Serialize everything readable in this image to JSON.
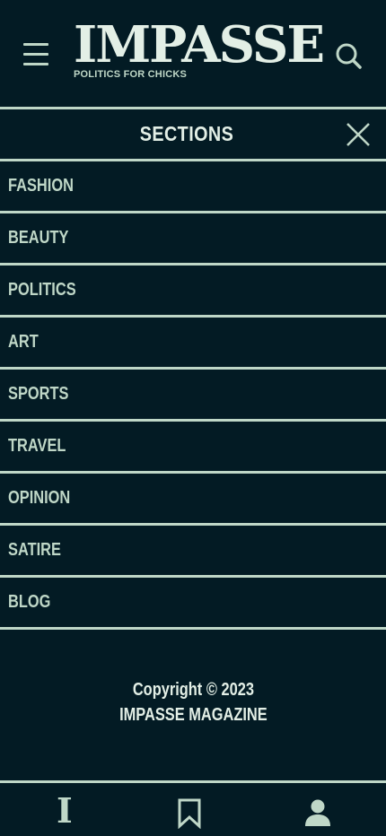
{
  "header": {
    "logo": "IMPASSE",
    "tagline": "POLITICS FOR CHICKS",
    "menu_icon": "hamburger-menu-icon",
    "search_icon": "search-icon"
  },
  "sections": {
    "title": "SECTIONS",
    "close_icon": "close-icon",
    "items": [
      {
        "label": "FASHION"
      },
      {
        "label": "BEAUTY"
      },
      {
        "label": "POLITICS"
      },
      {
        "label": "ART"
      },
      {
        "label": "SPORTS"
      },
      {
        "label": "TRAVEL"
      },
      {
        "label": "OPINION"
      },
      {
        "label": "SATIRE"
      },
      {
        "label": "BLOG"
      }
    ]
  },
  "footer": {
    "copyright": "Copyright © 2023",
    "company": "IMPASSE MAGAZINE"
  },
  "bottom_nav": {
    "items": [
      {
        "icon": "home-logo-icon",
        "glyph": "I"
      },
      {
        "icon": "bookmark-icon"
      },
      {
        "icon": "user-account-icon"
      }
    ]
  },
  "colors": {
    "background": "#031b24",
    "accent": "#bfd7c7",
    "text_light": "#e3efe6"
  }
}
